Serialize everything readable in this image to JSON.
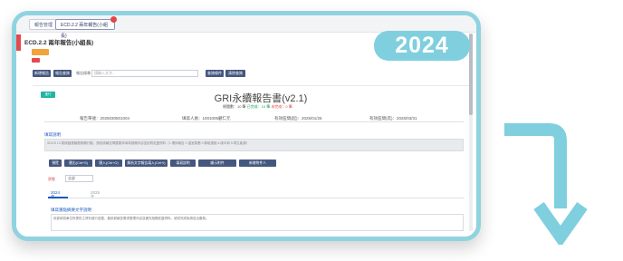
{
  "year_badge": "2024",
  "tabs": [
    {
      "label": "報告管理"
    },
    {
      "label": "ECD.2.2 兩年報告(小組長)"
    }
  ],
  "page_title": "ECD.2.2 兩年報告(小組長)",
  "toolbar": {
    "btn1": "新增報告",
    "btn2": "報告查詢",
    "search_label": "報告搜尋",
    "search_placeholder": "請輸入文字...",
    "btn3": "查詢條件",
    "btn4": "清除查詢"
  },
  "report": {
    "tag": "進行",
    "title": "GRI永續報告書(v2.1)",
    "subtitle": {
      "prefix": "總題數：10 筆",
      "completed": "已完成：10 筆",
      "pending": "未完成：0 筆"
    },
    "meta": [
      "報告單號：2025030501004",
      "填寫人員：1001005顧仁元",
      "有效區間(起)：2025/01/25",
      "有效區間(迄)：2025/03/31"
    ],
    "notes_label": "填寫說明",
    "notes_text": "SDGS 13 氣候變遷議題相關行動，請依據報告揭露要求填寫相關內容並檢附佐證資料（1.環評報告 2.溫室氣體 3.節能措施 4.碳中和 5.再生能源）"
  },
  "actions": [
    "預覽",
    "匯出(Ctrl+S)",
    "匯入(Ctrl+O)",
    "解析文字報告填入(Ctrl+I)",
    "填寫說明",
    "顯示附件",
    "新增附件人"
  ],
  "select": {
    "label": "狀態",
    "value": "全部"
  },
  "subtabs": [
    "2024年",
    "2025年"
  ],
  "section2": "填寫重點摘要文字說明",
  "textarea": "依據填寫單位所提供之資料進行彙整，擬依據報告需求整理內容並補充相關佐證資料。填寫完成後請送出審核。"
}
